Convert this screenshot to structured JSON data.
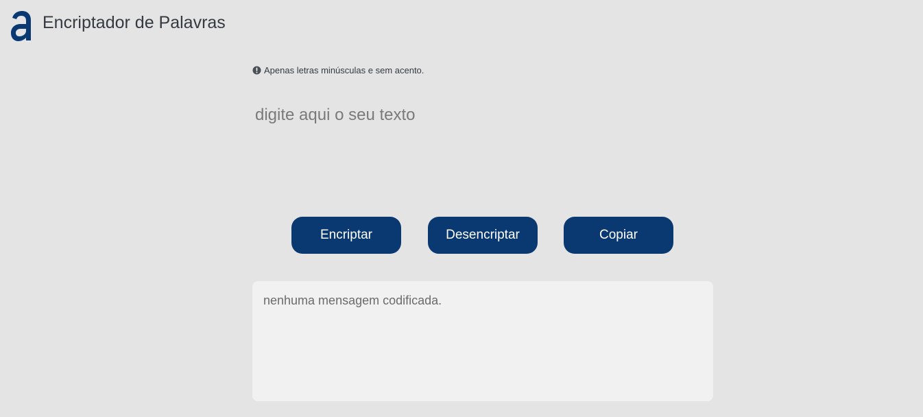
{
  "header": {
    "logo_icon": "alura-a-logo-icon",
    "title": "Encriptador de Palavras"
  },
  "input_section": {
    "hint_icon": "info-circle-icon",
    "hint_text": "Apenas letras minúsculas e sem acento.",
    "placeholder": "digite aqui o seu texto",
    "value": ""
  },
  "actions": {
    "encrypt_label": "Encriptar",
    "decrypt_label": "Desencriptar",
    "copy_label": "Copiar"
  },
  "output": {
    "message": "nenhuma mensagem codificada."
  },
  "colors": {
    "background": "#e4e4e4",
    "primary": "#0a3871",
    "output_background": "#f1f1f1"
  }
}
